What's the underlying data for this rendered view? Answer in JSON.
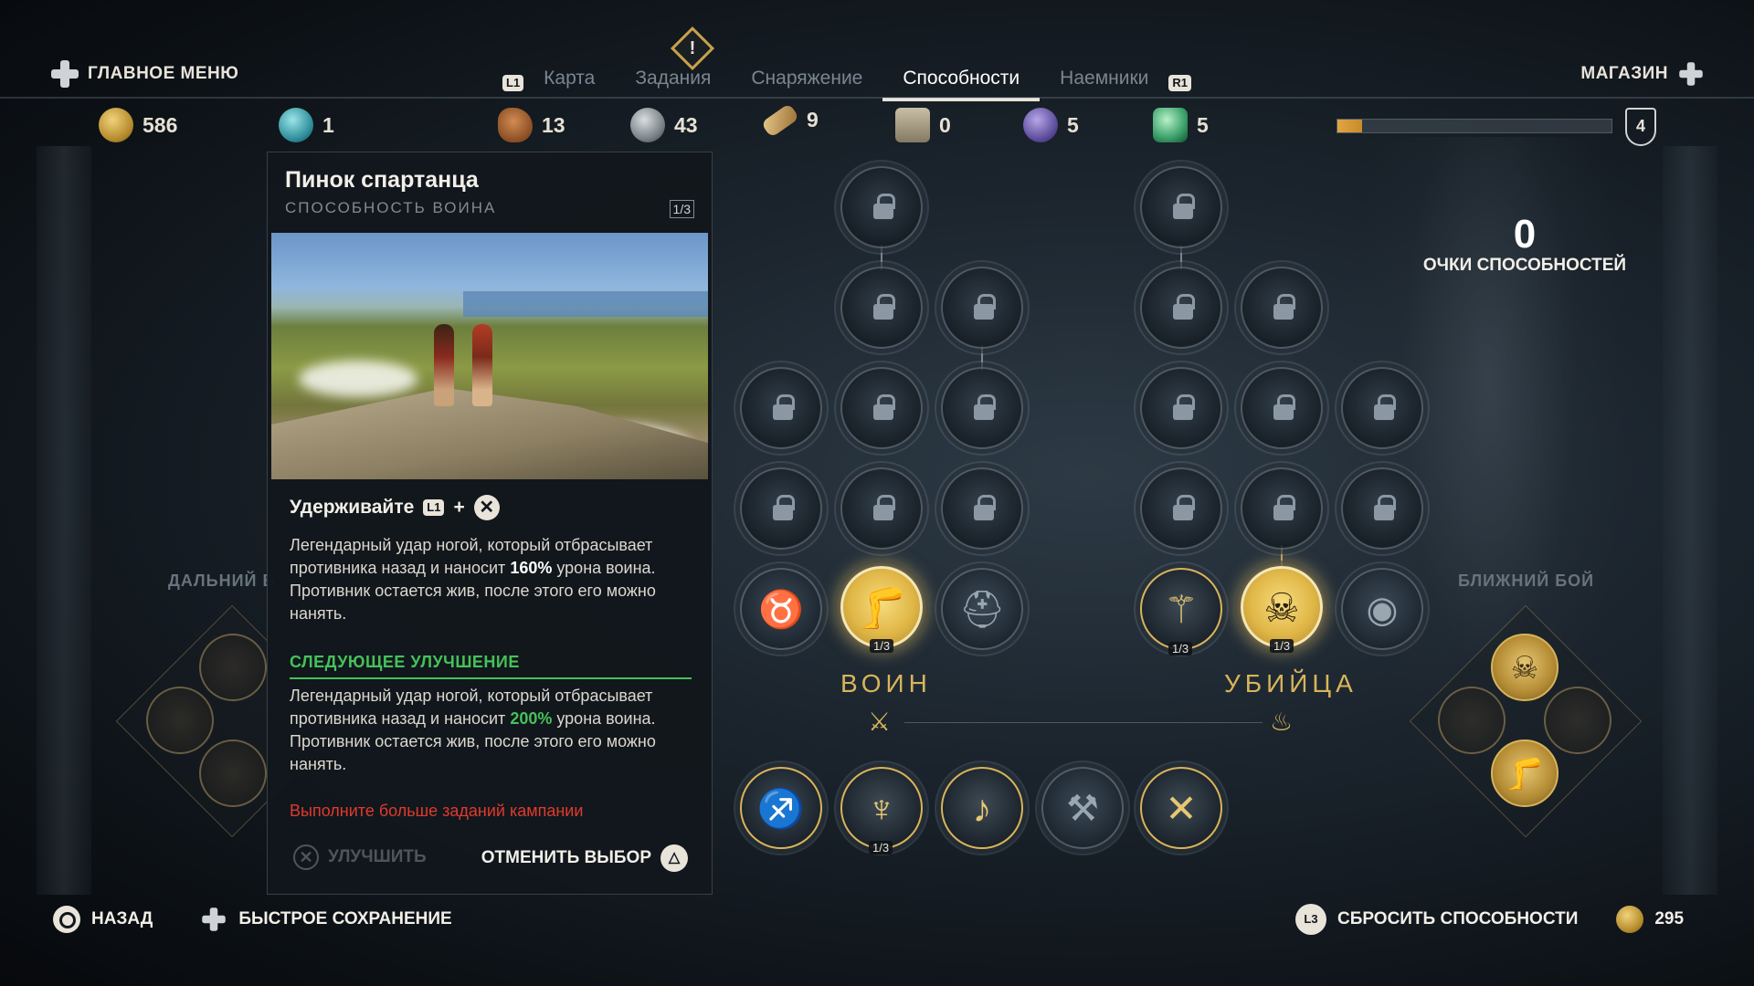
{
  "nav": {
    "main_menu": "ГЛАВНОЕ МЕНЮ",
    "shop": "МАГАЗИН",
    "left_button": "L1",
    "right_button": "R1",
    "tabs": [
      {
        "label": "Карта",
        "active": false
      },
      {
        "label": "Задания",
        "active": false
      },
      {
        "label": "Снаряжение",
        "active": false
      },
      {
        "label": "Способности",
        "active": true
      },
      {
        "label": "Наемники",
        "active": false
      }
    ],
    "alert_glyph": "!"
  },
  "resources": [
    {
      "icon": "drachmae-coin-icon",
      "value": "586"
    },
    {
      "icon": "ability-gem-icon",
      "value": "1"
    },
    {
      "icon": "animal-hide-icon",
      "value": "13"
    },
    {
      "icon": "iron-ore-icon",
      "value": "43"
    },
    {
      "icon": "softwood-icon",
      "value": "9"
    },
    {
      "icon": "ancient-tablet-icon",
      "value": "0"
    },
    {
      "icon": "obsidian-glass-icon",
      "value": "5"
    },
    {
      "icon": "crystal-icon",
      "value": "5"
    }
  ],
  "xp": {
    "progress_fraction": 0.09,
    "level": "4"
  },
  "panel": {
    "title": "Пинок спартанца",
    "subtitle": "СПОСОБНОСТЬ ВОИНА",
    "badge": "1/3",
    "hold_label": "Удерживайте",
    "hold_button": "L1",
    "plus": "+",
    "x_button": "✕",
    "desc_1": "Легендарный удар ногой, который отбрасывает противника назад и наносит",
    "desc_1_pct": "160%",
    "desc_1_tail": "урона воина. Противник остается жив, после этого его можно нанять.",
    "next_header": "СЛЕДУЮЩЕЕ УЛУЧШЕНИЕ",
    "desc_2": "Легендарный удар ногой, который отбрасывает противника назад и наносит",
    "desc_2_pct": "200%",
    "desc_2_tail": "урона воина. Противник остается жив, после этого его можно нанять.",
    "requirement": "Выполните больше заданий кампании",
    "upgrade_label": "УЛУЧШИТЬ",
    "cancel_label": "ОТМЕНИТЬ ВЫБОР",
    "triangle_glyph": "△"
  },
  "trees": {
    "warrior_label": "ВОИН",
    "assassin_label": "УБИЙЦА",
    "ranged_label": "ДАЛЬНИЙ Б",
    "melee_label": "БЛИЖНИЙ БОЙ",
    "points_value": "0",
    "points_label": "ОЧКИ СПОСОБНОСТЕЙ",
    "level_tags": {
      "sparta_kick": "1/3",
      "hero_strike": "1/3",
      "poison": "1/3",
      "second_wind": "1/3"
    }
  },
  "bottom": {
    "back_label": "НАЗАД",
    "quicksave_label": "БЫСТРОЕ СОХРАНЕНИЕ",
    "reset_label": "СБРОСИТЬ СПОСОБНОСТИ",
    "l3_button": "L3",
    "reset_cost": "295"
  }
}
